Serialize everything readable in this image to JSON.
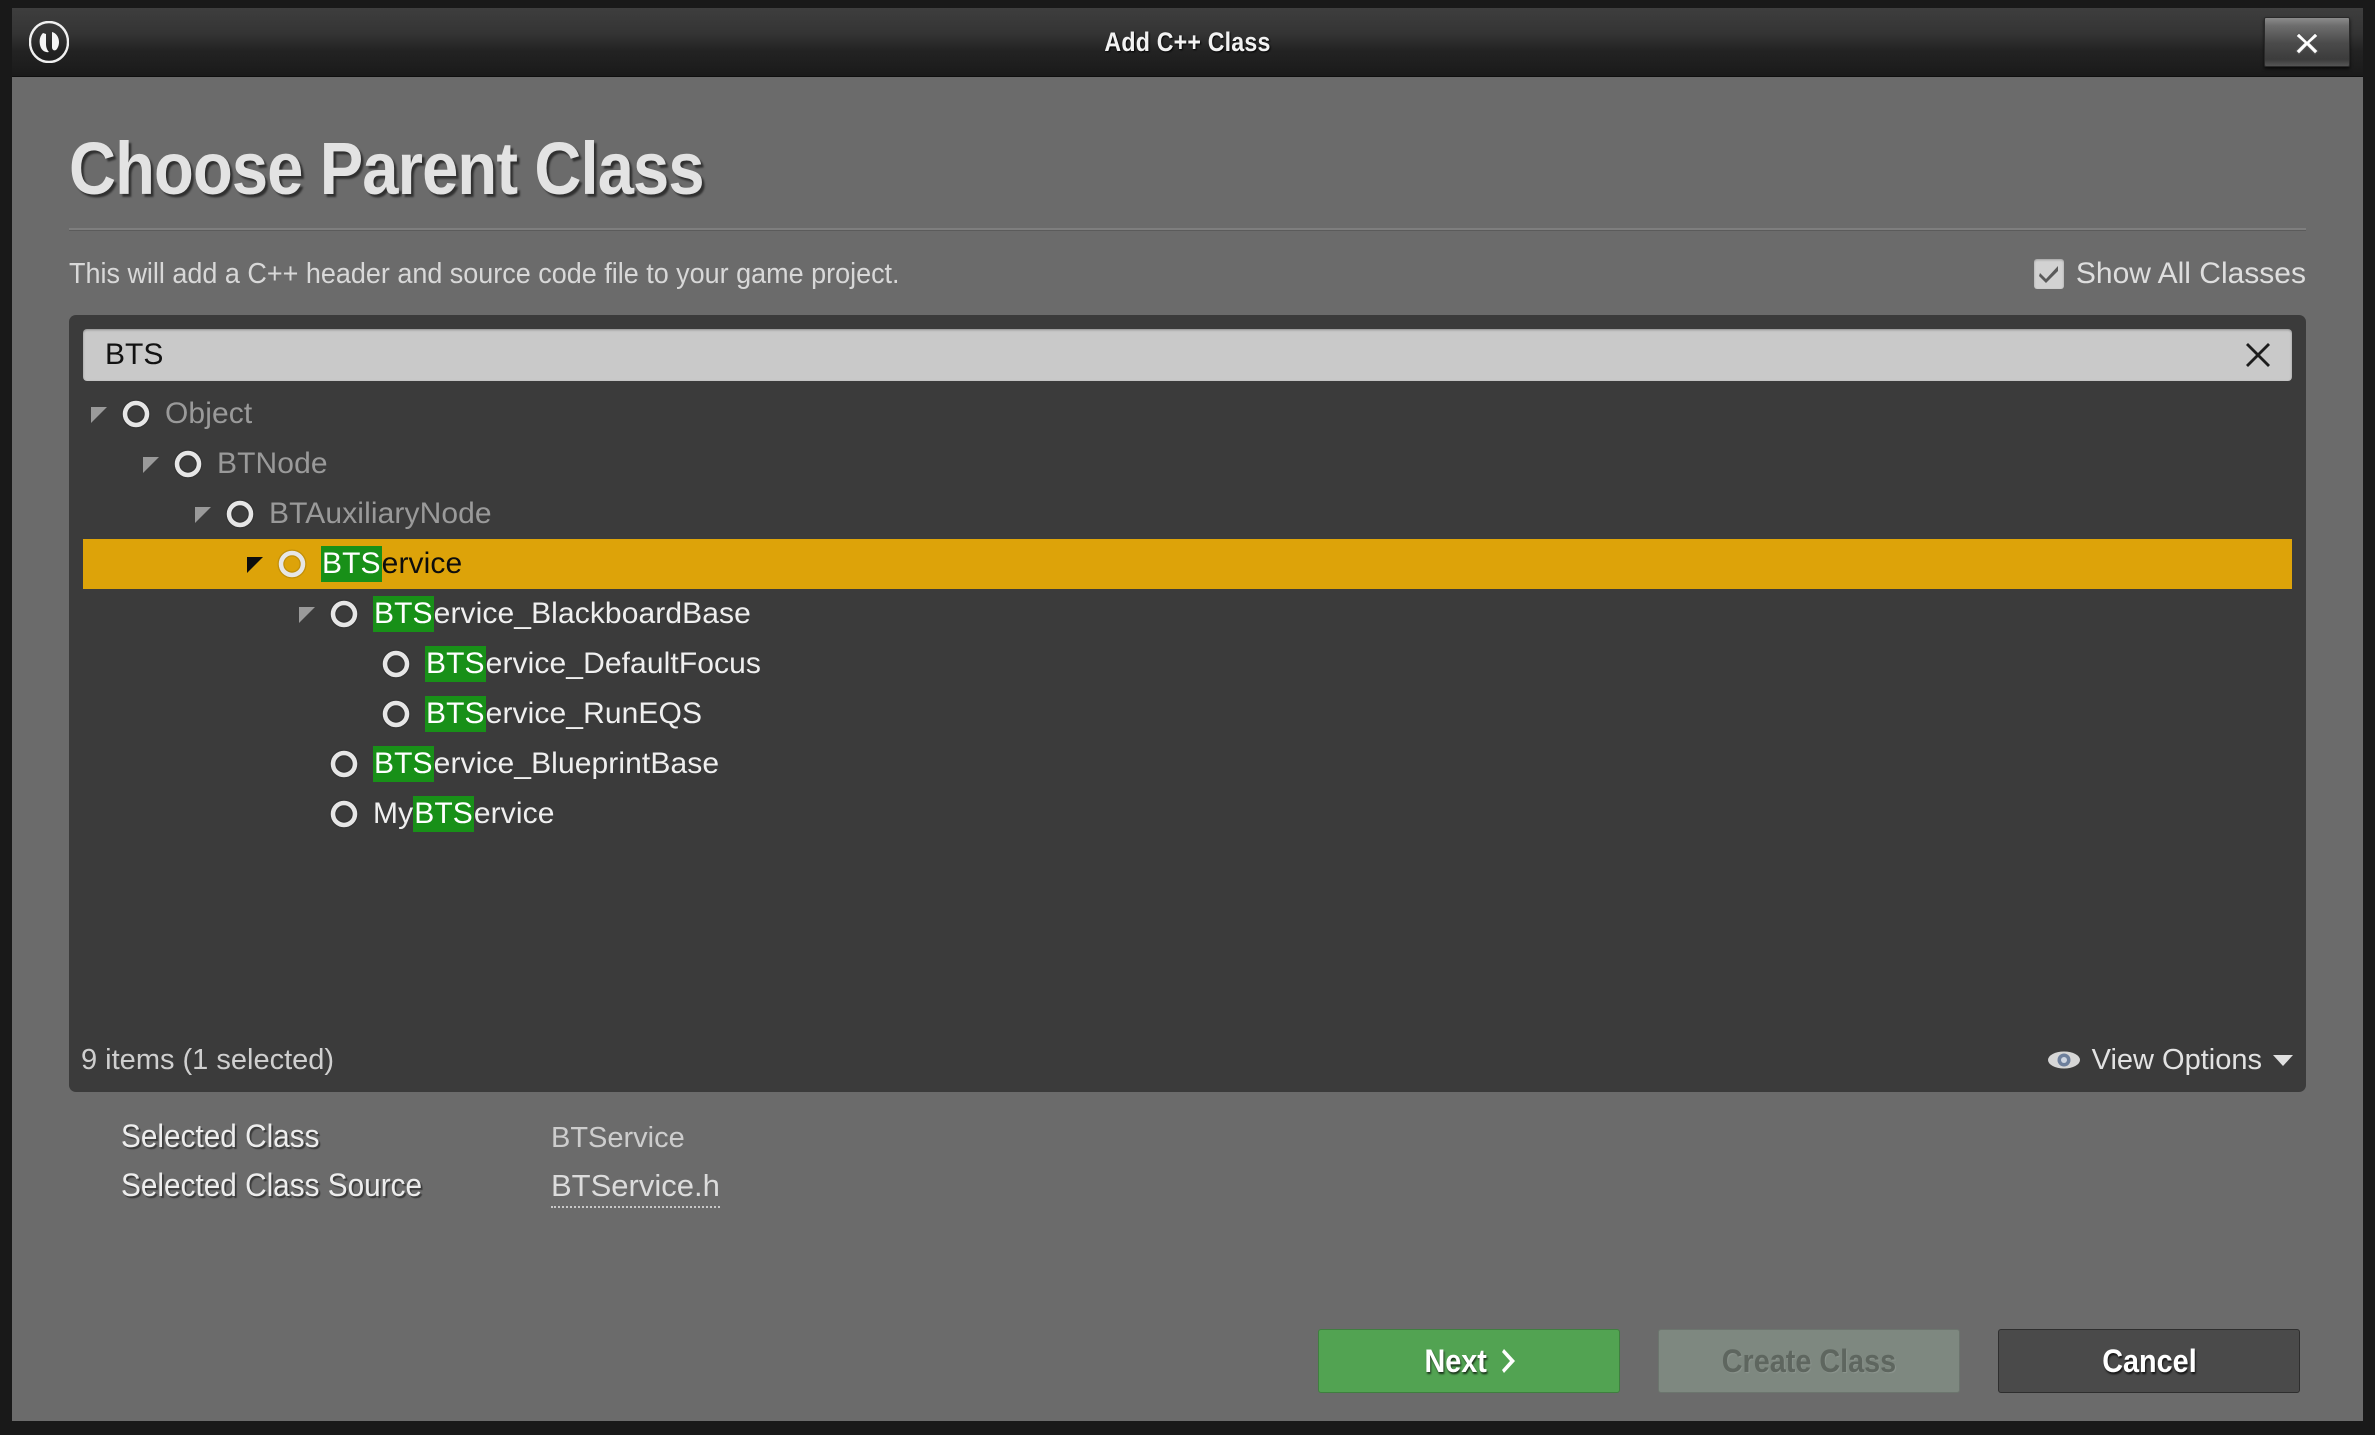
{
  "window": {
    "title": "Add C++ Class",
    "logo_icon": "unreal-engine-logo",
    "close_icon": "close-icon"
  },
  "header": {
    "page_title": "Choose Parent Class",
    "subtitle": "This will add a C++ header and source code file to your game project.",
    "show_all_classes": {
      "label": "Show All Classes",
      "checked": true,
      "icon": "checkmark-icon"
    }
  },
  "search": {
    "value": "BTS",
    "placeholder": "Search Classes",
    "clear_icon": "close-icon"
  },
  "tree": {
    "items": [
      {
        "name": "Object",
        "indent": 0,
        "has_arrow": true,
        "expanded": true,
        "selected": false,
        "state": "dim",
        "parts": [
          {
            "t": "Object",
            "hl": false
          }
        ]
      },
      {
        "name": "BTNode",
        "indent": 1,
        "has_arrow": true,
        "expanded": true,
        "selected": false,
        "state": "dim",
        "parts": [
          {
            "t": "BTNode",
            "hl": false
          }
        ]
      },
      {
        "name": "BTAuxiliaryNode",
        "indent": 2,
        "has_arrow": true,
        "expanded": true,
        "selected": false,
        "state": "dim",
        "parts": [
          {
            "t": "BTAuxiliaryNode",
            "hl": false
          }
        ]
      },
      {
        "name": "BTService",
        "indent": 3,
        "has_arrow": true,
        "expanded": true,
        "selected": true,
        "state": "sel",
        "parts": [
          {
            "t": "BTS",
            "hl": true
          },
          {
            "t": "ervice",
            "hl": false
          }
        ]
      },
      {
        "name": "BTService_BlackboardBase",
        "indent": 4,
        "has_arrow": true,
        "expanded": true,
        "selected": false,
        "state": "norm",
        "parts": [
          {
            "t": "BTS",
            "hl": true
          },
          {
            "t": "ervice_BlackboardBase",
            "hl": false
          }
        ]
      },
      {
        "name": "BTService_DefaultFocus",
        "indent": 5,
        "has_arrow": false,
        "expanded": false,
        "selected": false,
        "state": "norm",
        "parts": [
          {
            "t": "BTS",
            "hl": true
          },
          {
            "t": "ervice_DefaultFocus",
            "hl": false
          }
        ]
      },
      {
        "name": "BTService_RunEQS",
        "indent": 5,
        "has_arrow": false,
        "expanded": false,
        "selected": false,
        "state": "norm",
        "parts": [
          {
            "t": "BTS",
            "hl": true
          },
          {
            "t": "ervice_RunEQS",
            "hl": false
          }
        ]
      },
      {
        "name": "BTService_BlueprintBase",
        "indent": 4,
        "has_arrow": false,
        "expanded": false,
        "selected": false,
        "state": "norm",
        "parts": [
          {
            "t": "BTS",
            "hl": true
          },
          {
            "t": "ervice_BlueprintBase",
            "hl": false
          }
        ]
      },
      {
        "name": "MyBTService",
        "indent": 4,
        "has_arrow": false,
        "expanded": false,
        "selected": false,
        "state": "norm",
        "parts": [
          {
            "t": "My",
            "hl": false
          },
          {
            "t": "BTS",
            "hl": true
          },
          {
            "t": "ervice",
            "hl": false
          }
        ]
      }
    ],
    "footer": {
      "item_count": "9 items (1 selected)",
      "view_options_label": "View Options",
      "view_options_icon": "eye-icon",
      "view_options_chevron": "chevron-down-icon"
    }
  },
  "selection_info": {
    "class_label": "Selected Class",
    "class_value": "BTService",
    "source_label": "Selected Class Source",
    "source_value": "BTService.h"
  },
  "buttons": {
    "next": "Next",
    "next_chevron": "chevron-right-icon",
    "create_class": "Create Class",
    "cancel": "Cancel"
  },
  "colors": {
    "selection_amber": "#DDA309",
    "match_highlight_green": "#189018",
    "next_green": "#52A352",
    "panel_bg": "#3B3B3B",
    "dialog_bg": "#6B6B6B"
  }
}
